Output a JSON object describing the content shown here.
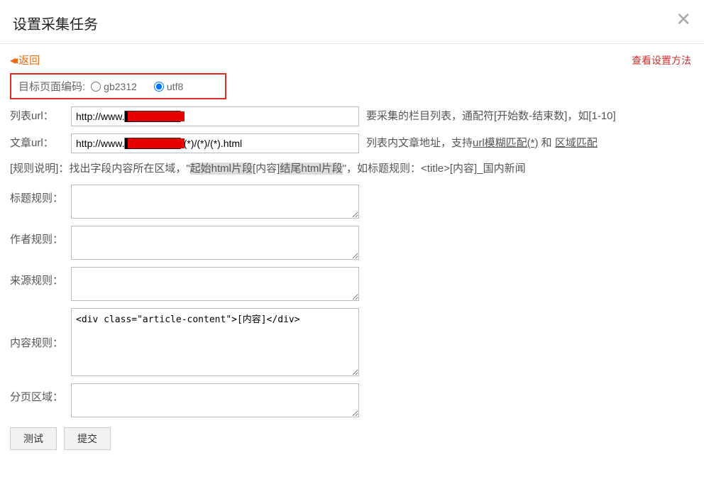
{
  "header": {
    "title": "设置采集任务",
    "close": "✕"
  },
  "top": {
    "back": "返回",
    "view_method": "查看设置方法"
  },
  "encoding": {
    "label": "目标页面编码:",
    "options": {
      "gb2312": "gb2312",
      "utf8": "utf8"
    },
    "selected": "utf8"
  },
  "list_url": {
    "label": "列表url：",
    "value": "http://www.████████/",
    "hint": "要采集的栏目列表，通配符[开始数-结束数]，如[1-10]"
  },
  "article_url": {
    "label": "文章url：",
    "value": "http://www.████████/(*)/(*)/(*).html",
    "hint_parts": {
      "a": "列表内文章地址，支持",
      "b": "url模糊匹配(*)",
      "c": " 和 ",
      "d": "区域匹配"
    }
  },
  "rule_desc": {
    "a": "[规则说明]：找出字段内容所在区域，\"",
    "b": "起始html片段",
    "c": "[内容]",
    "d": "结尾html片段",
    "e": "\"，如标题规则：<title>[内容]_国内新闻"
  },
  "title_rule": {
    "label": "标题规则：",
    "value": ""
  },
  "author_rule": {
    "label": "作者规则：",
    "value": ""
  },
  "source_rule": {
    "label": "来源规则：",
    "value": ""
  },
  "content_rule": {
    "label": "内容规则：",
    "value": "<div class=\"article-content\">[内容]</div>"
  },
  "page_rule": {
    "label": "分页区域：",
    "value": ""
  },
  "buttons": {
    "test": "测试",
    "submit": "提交"
  }
}
